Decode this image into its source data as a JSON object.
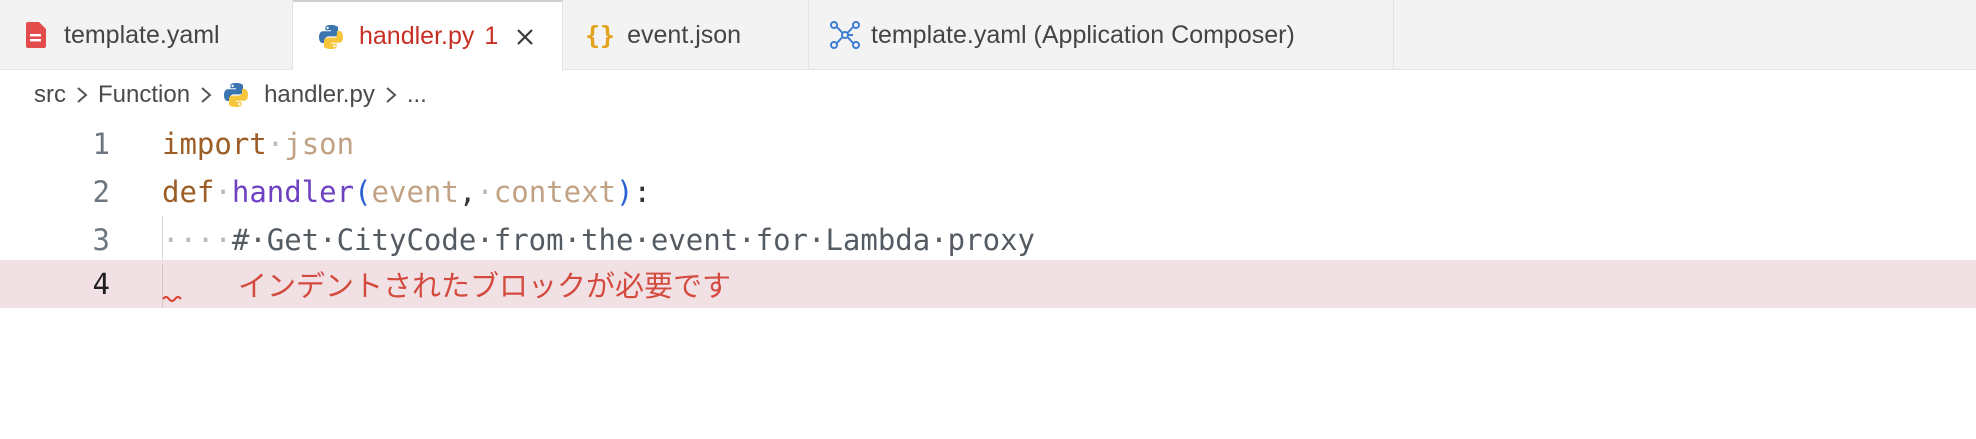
{
  "tabs": [
    {
      "label": "template.yaml",
      "icon": "yaml-file-icon",
      "active": false
    },
    {
      "label": "handler.py",
      "icon": "python-icon",
      "active": true,
      "badge": "1"
    },
    {
      "label": "event.json",
      "icon": "json-braces-icon",
      "active": false
    },
    {
      "label": "template.yaml (Application Composer)",
      "icon": "composer-icon",
      "active": false
    }
  ],
  "breadcrumb": {
    "items": [
      "src",
      "Function",
      "handler.py",
      "..."
    ]
  },
  "editor": {
    "line_numbers": [
      "1",
      "2",
      "3",
      "4"
    ],
    "current_line": "4",
    "line1": {
      "kw": "import",
      "ws": "·",
      "mod": "json"
    },
    "line2": {
      "kw": "def",
      "ws1": "·",
      "fn": "handler",
      "open": "(",
      "p1": "event",
      "comma": ",",
      "ws2": "·",
      "p2": "context",
      "close": ")",
      "colon": ":"
    },
    "line3": {
      "indent": "····",
      "comment": "#·Get·CityCode·from·the·event·for·Lambda·proxy"
    },
    "diagnostic": "インデントされたブロックが必要です"
  },
  "colors": {
    "error": "#d34a3f",
    "error_line_bg": "#f2e1e4",
    "keyword": "#9c5d27",
    "function": "#6f42c1",
    "paren": "#2b61d1"
  }
}
